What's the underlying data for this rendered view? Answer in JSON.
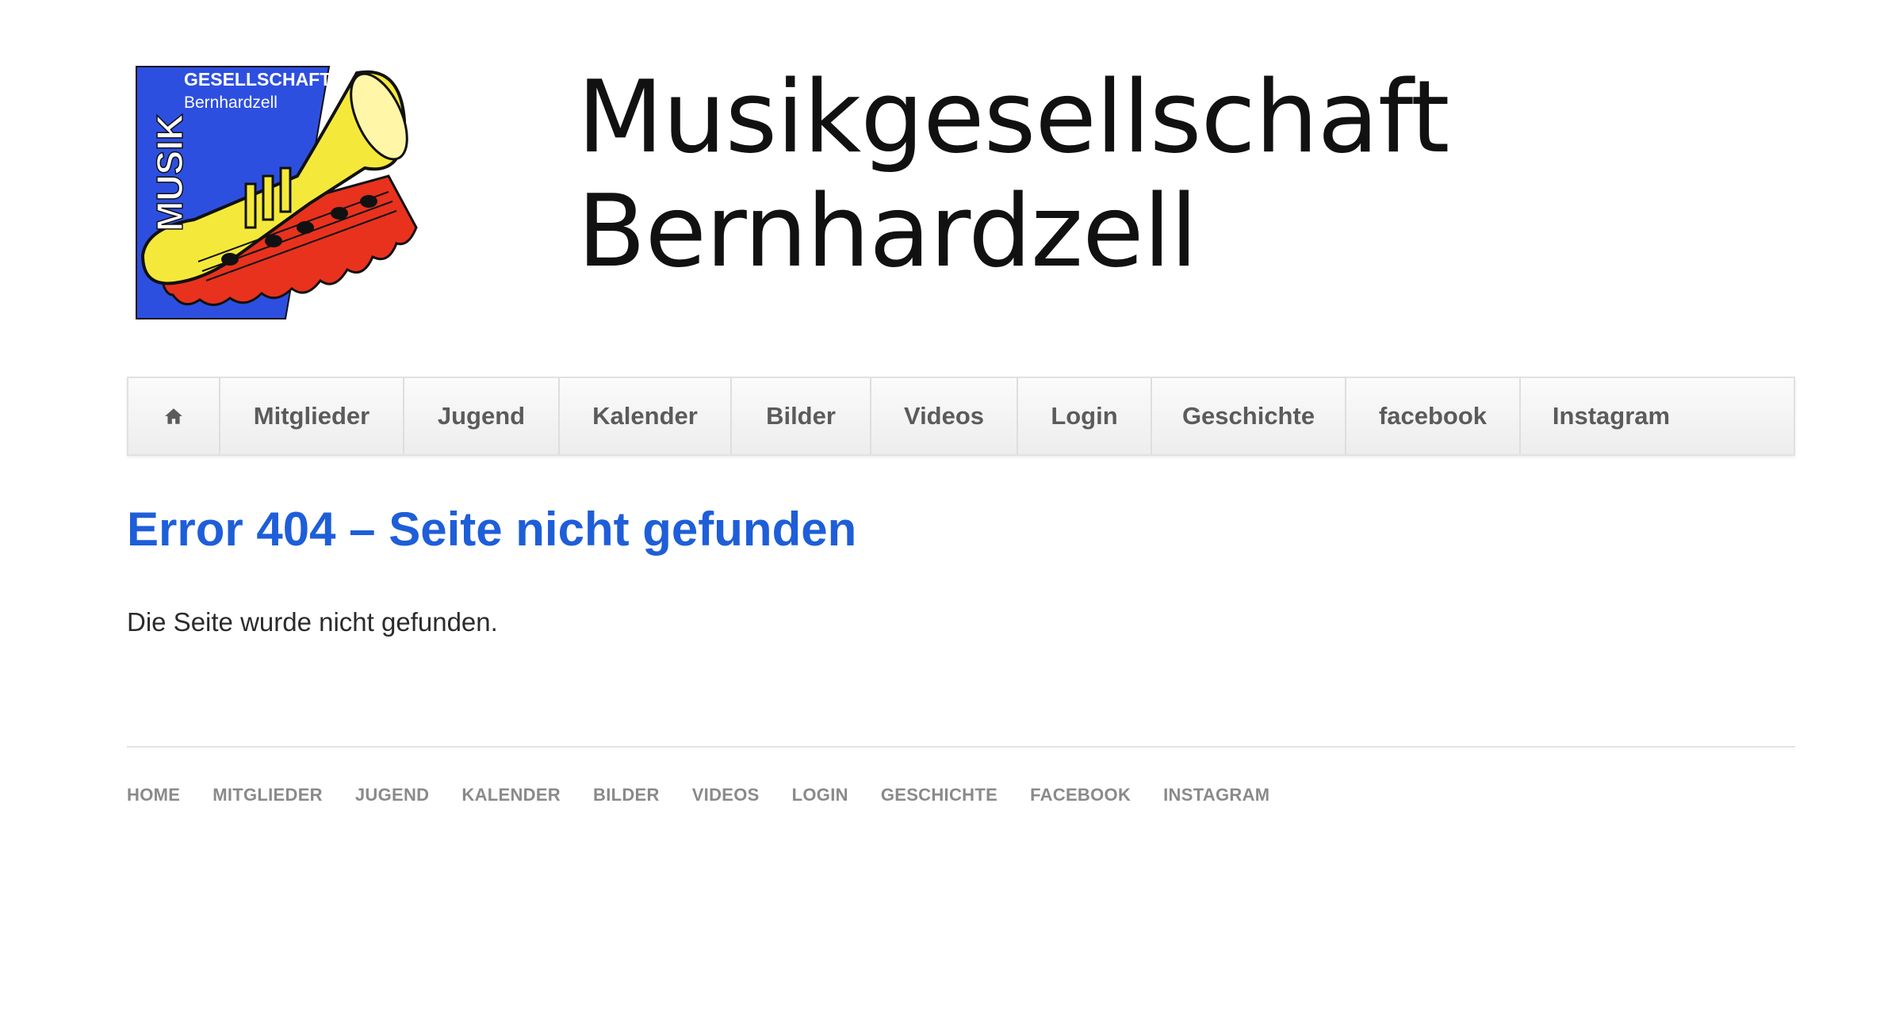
{
  "header": {
    "logo_alt": "Musik Gesellschaft Bernhardzell logo",
    "logo_text": {
      "vertical": "MUSIK",
      "line1": "GESELLSCHAFT",
      "line2": "Bernhardzell"
    },
    "title_line1": "Musikgesellschaft",
    "title_line2": "Bernhardzell"
  },
  "nav": {
    "home_icon": "home-icon",
    "items": [
      {
        "label": "Mitglieder"
      },
      {
        "label": "Jugend"
      },
      {
        "label": "Kalender"
      },
      {
        "label": "Bilder"
      },
      {
        "label": "Videos"
      },
      {
        "label": "Login"
      },
      {
        "label": "Geschichte"
      },
      {
        "label": "facebook"
      },
      {
        "label": "Instagram"
      }
    ]
  },
  "content": {
    "title": "Error 404 – Seite nicht gefunden",
    "text": "Die Seite wurde nicht gefunden."
  },
  "footer": {
    "items": [
      {
        "label": "Home"
      },
      {
        "label": "Mitglieder"
      },
      {
        "label": "Jugend"
      },
      {
        "label": "Kalender"
      },
      {
        "label": "Bilder"
      },
      {
        "label": "Videos"
      },
      {
        "label": "Login"
      },
      {
        "label": "Geschichte"
      },
      {
        "label": "facebook"
      },
      {
        "label": "Instagram"
      }
    ]
  },
  "colors": {
    "accent": "#1e5ed8",
    "logo_blue": "#2d4fe0",
    "logo_red": "#e8321e",
    "logo_yellow": "#f4e93a"
  }
}
